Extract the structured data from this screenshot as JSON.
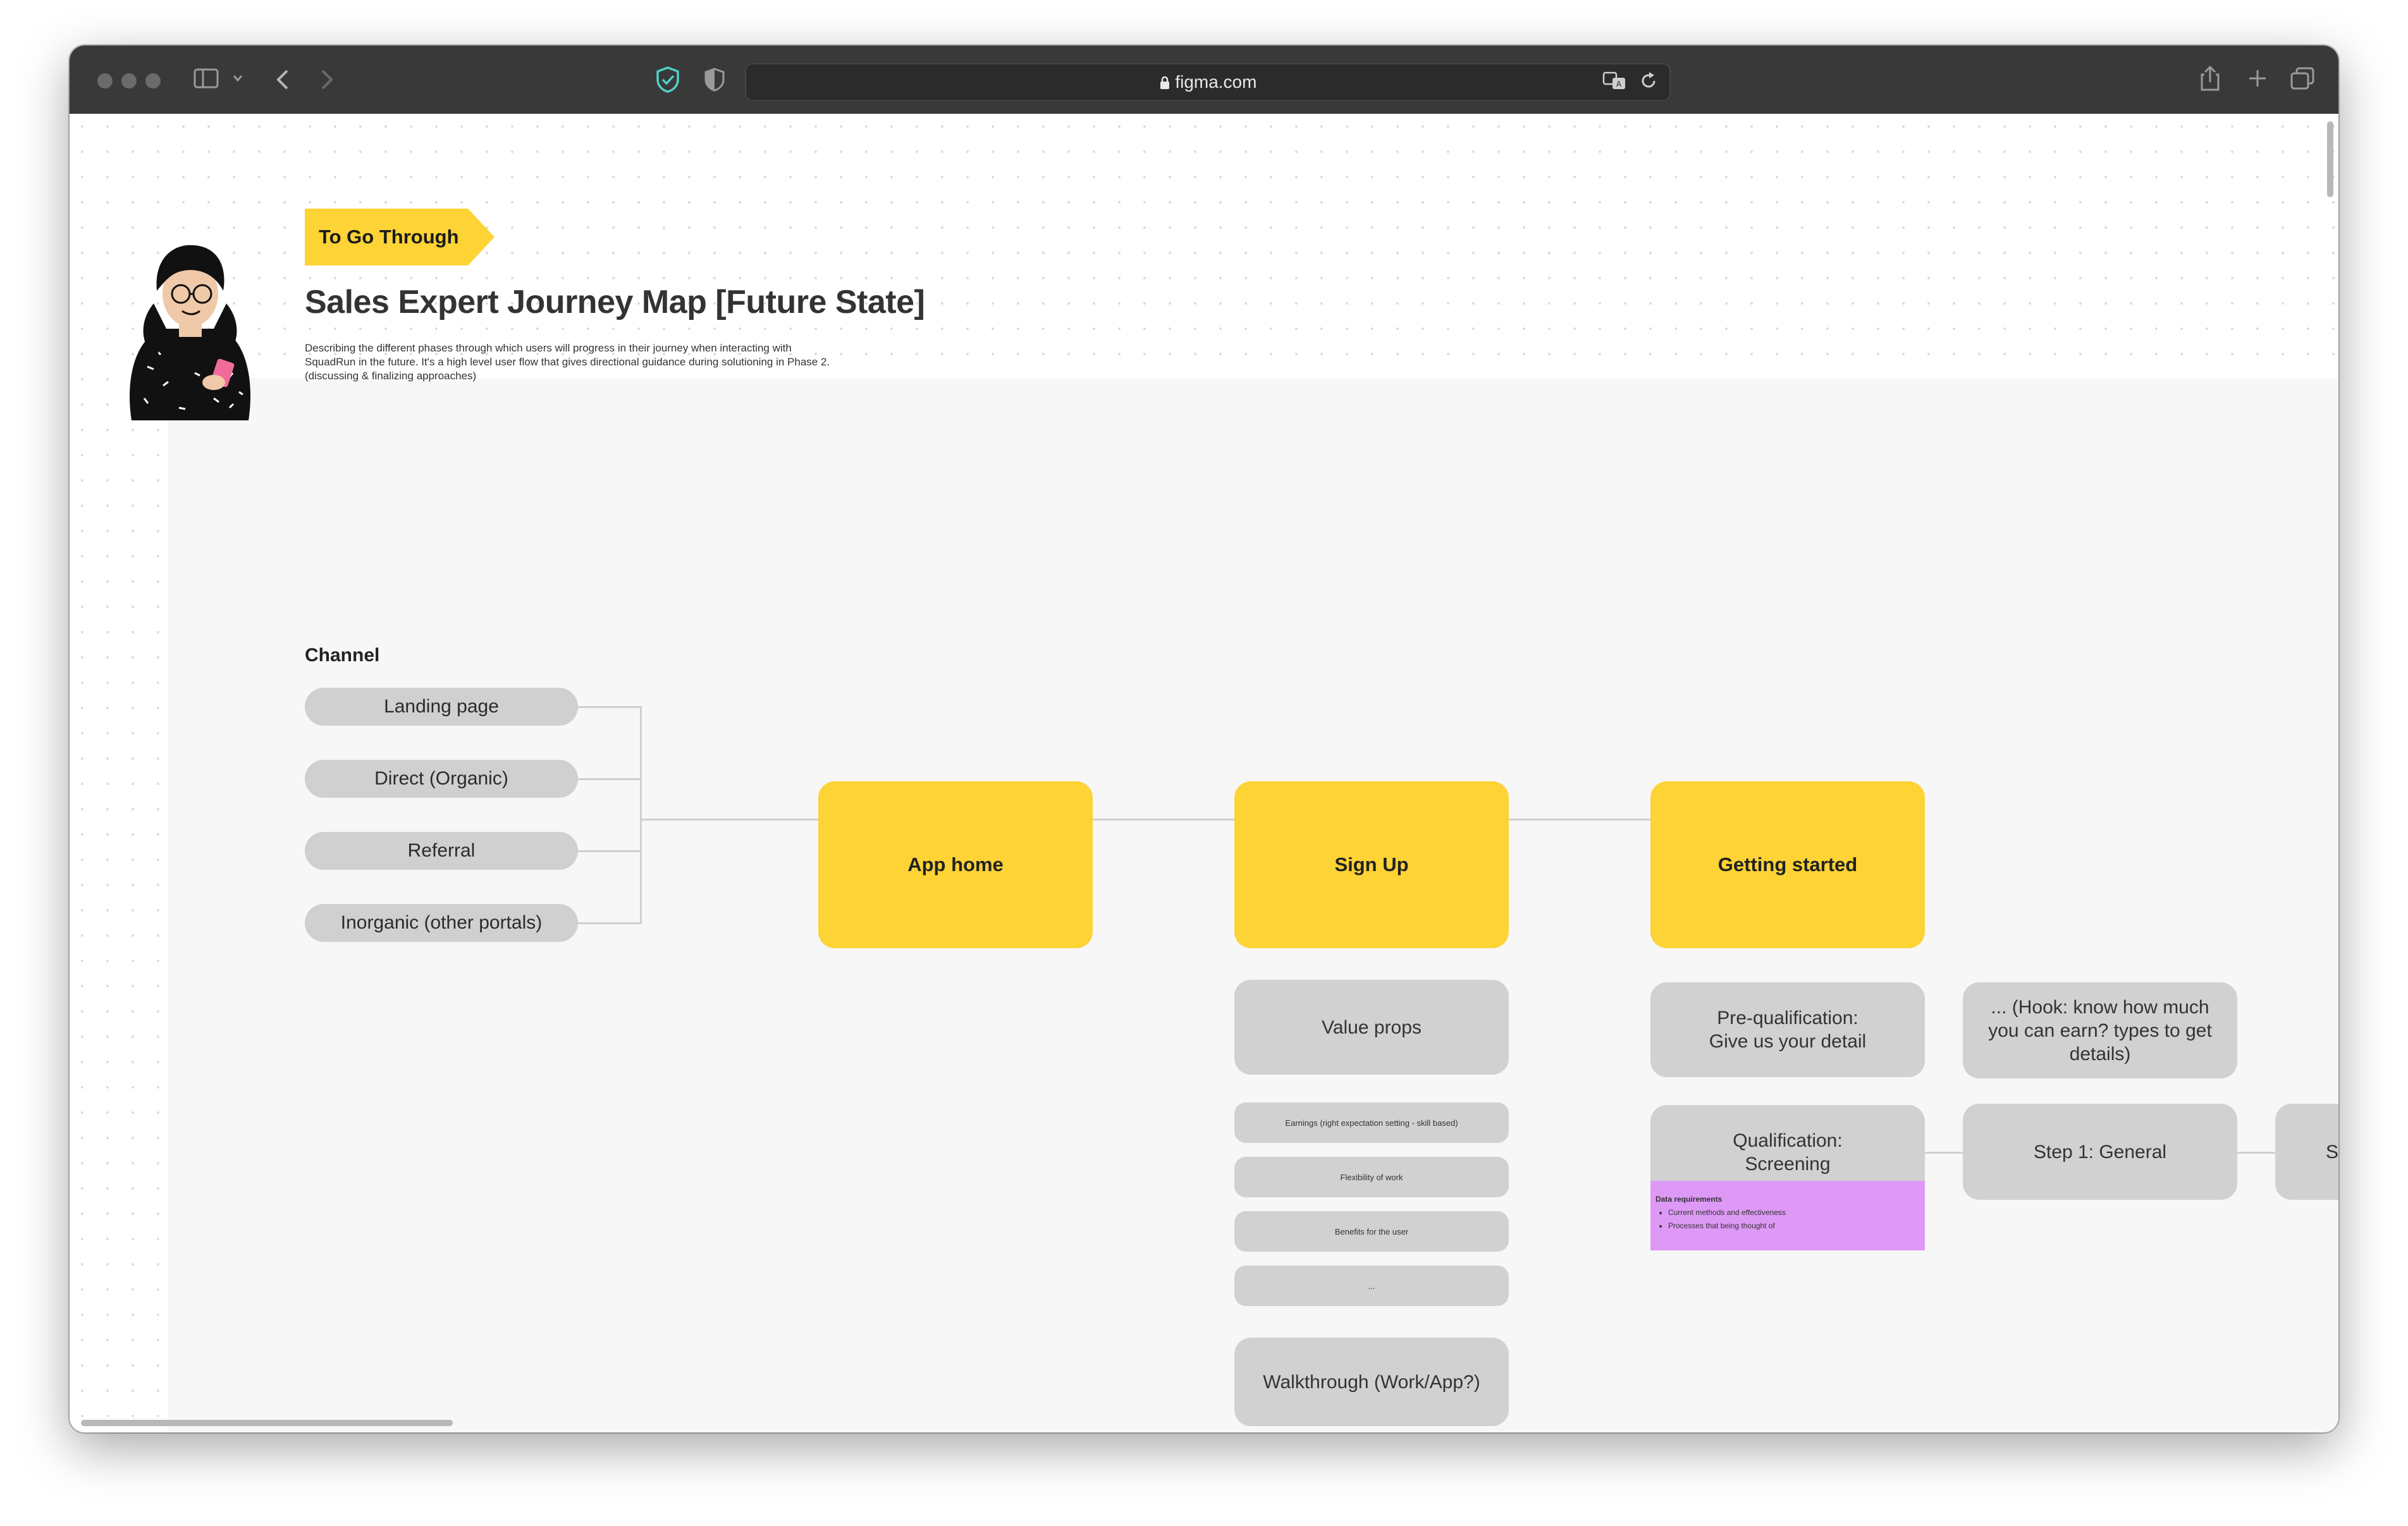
{
  "browser": {
    "url": "figma.com",
    "icons": [
      "sidebar-icon",
      "chevron-down-icon",
      "back-icon",
      "forward-icon",
      "shield-check-icon",
      "privacy-shield-icon",
      "lock-icon",
      "translate-icon",
      "reload-icon",
      "share-icon",
      "new-tab-icon",
      "tabs-overview-icon"
    ]
  },
  "header": {
    "tag": "To Go Through",
    "title": "Sales Expert Journey Map [Future State]",
    "description_lines": [
      "Describing the different phases through which users will progress in their journey when interacting with",
      "SquadRun in the future. It's a high level user flow that gives directional guidance during solutioning in Phase 2.",
      "(discussing & finalizing approaches)"
    ]
  },
  "channel": {
    "label": "Channel",
    "items": [
      "Landing page",
      "Direct (Organic)",
      "Referral",
      "Inorganic (other portals)"
    ]
  },
  "stages": [
    "App home",
    "Sign Up",
    "Getting started"
  ],
  "signup": {
    "value_props": "Value props",
    "sub_items": [
      "Earnings (right expectation setting - skill based)",
      "Flexibility of work",
      "Benefits for the user",
      "..."
    ],
    "walkthrough": "Walkthrough (Work/App?)"
  },
  "getting_started": {
    "prequal_lines": [
      "Pre-qualification:",
      "Give us your detail"
    ],
    "hook_lines": [
      "... (Hook: know how much",
      "you can earn? types to get",
      "details)"
    ],
    "qual_lines": [
      "Qualification:",
      "Screening"
    ],
    "step1": "Step 1: General",
    "step2_partial": "S"
  },
  "note": {
    "title": "Data requirements",
    "items": [
      "Current methods and effectiveness",
      "Processes that being thought of"
    ],
    "color": "#dd99f5"
  },
  "colors": {
    "yellow": "#fdd335",
    "grey_card": "#d1d1d1",
    "chrome": "#393939"
  }
}
